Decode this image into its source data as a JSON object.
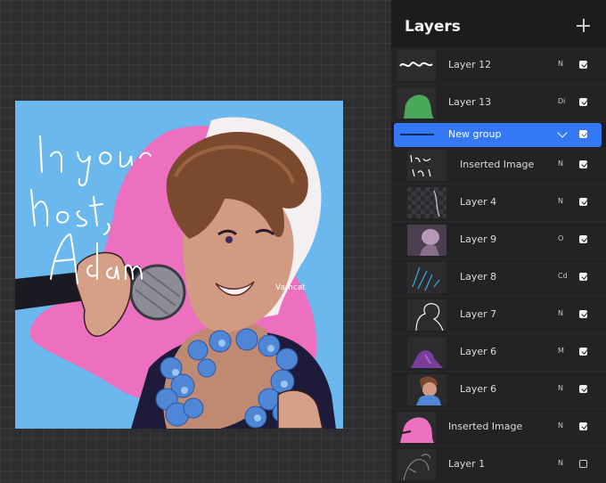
{
  "panel": {
    "title": "Layers",
    "add_icon": "plus-icon"
  },
  "artwork": {
    "lettering": [
      "In your",
      "host,",
      "Adam"
    ],
    "signature": "Vamcat"
  },
  "layers": [
    {
      "name": "Layer 12",
      "blend": "N",
      "visible": true,
      "indent": false
    },
    {
      "name": "Layer 13",
      "blend": "Di",
      "visible": true,
      "indent": false
    },
    {
      "name": "New group",
      "blend": "",
      "visible": true,
      "indent": false,
      "group": true,
      "selected": true
    },
    {
      "name": "Inserted Image",
      "blend": "N",
      "visible": true,
      "indent": true
    },
    {
      "name": "Layer 4",
      "blend": "N",
      "visible": true,
      "indent": true
    },
    {
      "name": "Layer 9",
      "blend": "O",
      "visible": true,
      "indent": true
    },
    {
      "name": "Layer 8",
      "blend": "Cd",
      "visible": true,
      "indent": true
    },
    {
      "name": "Layer 7",
      "blend": "N",
      "visible": true,
      "indent": true
    },
    {
      "name": "Layer 6",
      "blend": "M",
      "visible": true,
      "indent": true
    },
    {
      "name": "Layer 6",
      "blend": "N",
      "visible": true,
      "indent": true
    },
    {
      "name": "Inserted Image",
      "blend": "N",
      "visible": true,
      "indent": false
    },
    {
      "name": "Layer 1",
      "blend": "N",
      "visible": false,
      "indent": false
    }
  ],
  "colors": {
    "accent": "#3478f6",
    "panel_bg": "#1c1c1e",
    "canvas_bg": "#2f2f31",
    "art_sky": "#6bb8ee",
    "art_pink": "#ec6fc0"
  }
}
